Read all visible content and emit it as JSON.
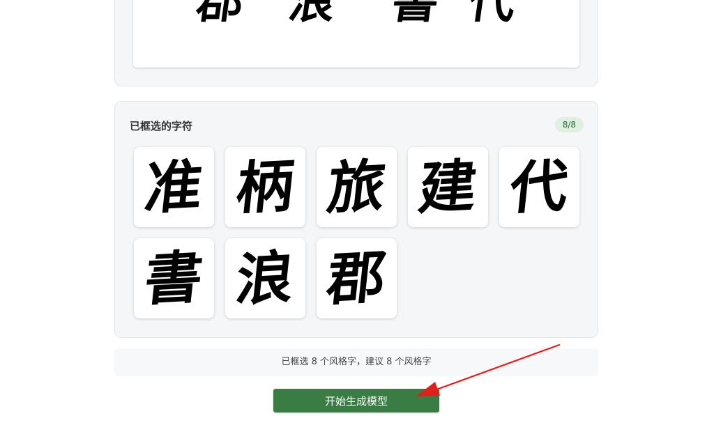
{
  "preview": {
    "chars": [
      "郡",
      "浪",
      "書",
      "代"
    ]
  },
  "selected": {
    "title": "已框选的字符",
    "count_badge": "8/8",
    "chars": [
      "准",
      "柄",
      "旅",
      "建",
      "代",
      "書",
      "浪",
      "郡"
    ]
  },
  "hint": {
    "text": "已框选 8 个风格字，建议 8 个风格字"
  },
  "actions": {
    "generate_label": "开始生成模型"
  },
  "colors": {
    "button": "#3a7d44",
    "badge_bg": "#dff0e1",
    "badge_text": "#2c6b33",
    "annotation": "#e0201c"
  },
  "icons": {
    "annotation": "red-arrow-icon"
  }
}
